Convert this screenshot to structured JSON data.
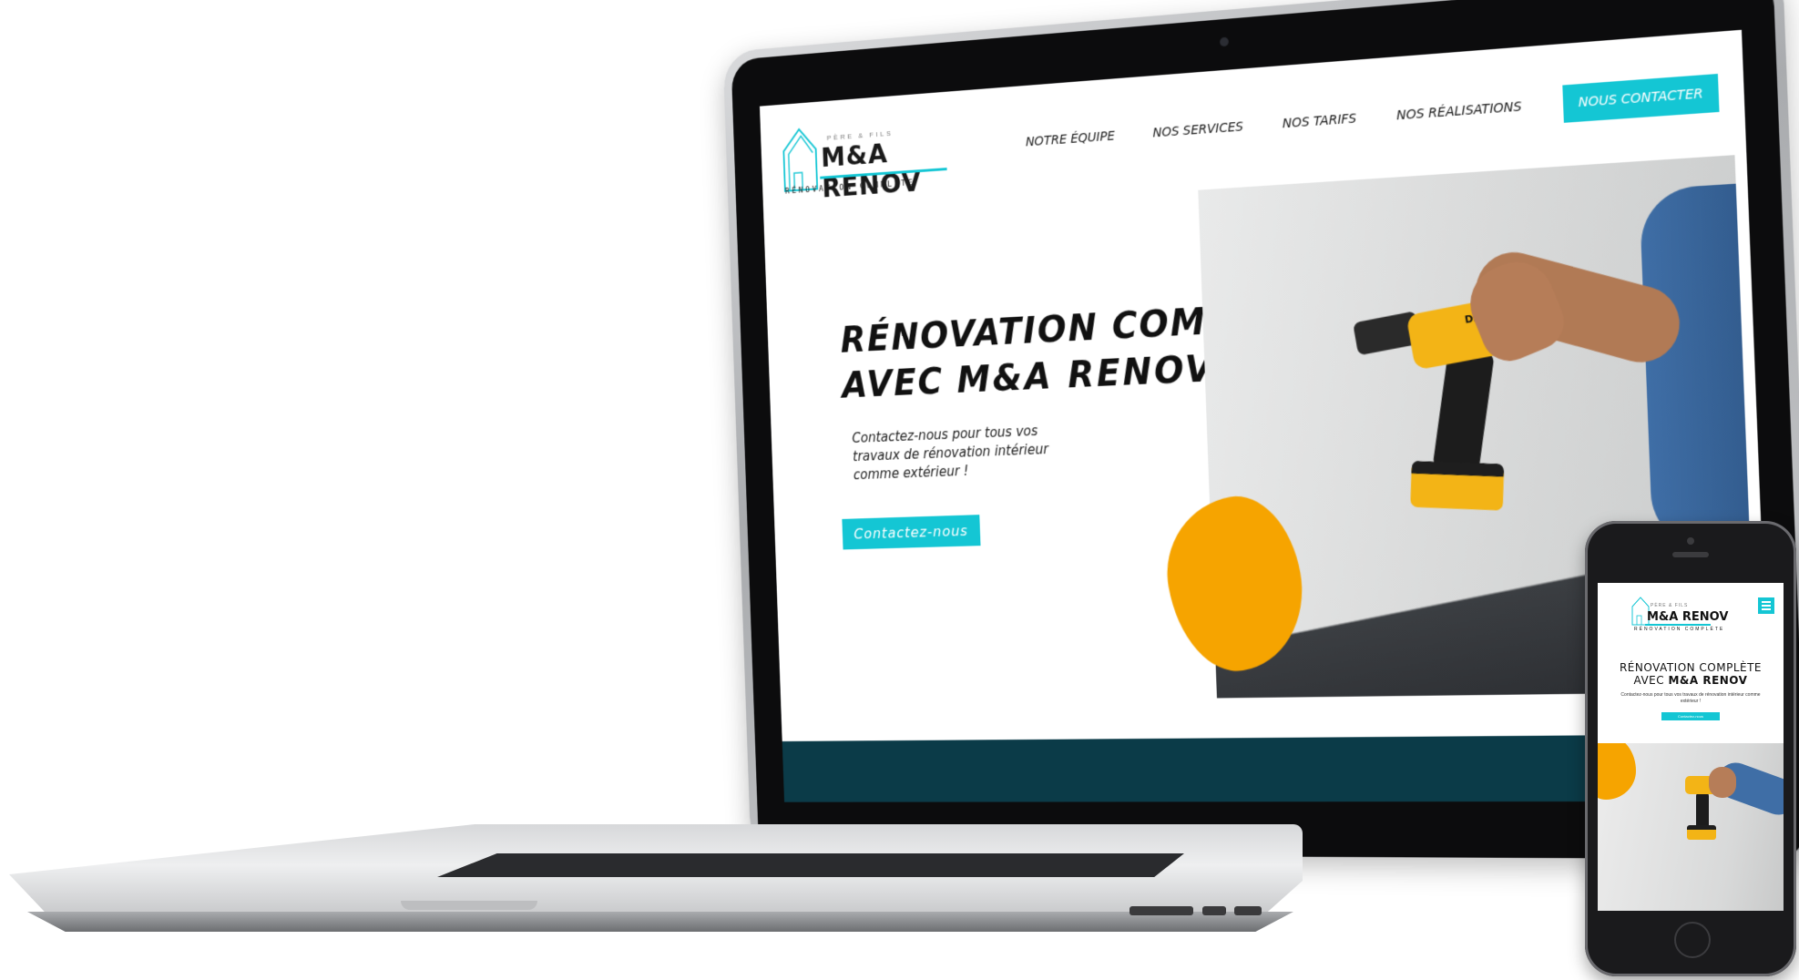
{
  "site": {
    "logo": {
      "tagline_small": "PÈRE & FILS",
      "name": "M&A RENOV",
      "subtitle": "RÉNOVATION COMPLÈTE"
    },
    "nav": {
      "items": [
        {
          "label": "NOTRE ÉQUIPE"
        },
        {
          "label": "NOS SERVICES"
        },
        {
          "label": "NOS TARIFS"
        },
        {
          "label": "NOS RÉALISATIONS"
        }
      ],
      "cta_label": "NOUS CONTACTER"
    },
    "hero": {
      "title_line1": "RÉNOVATION COMPLÈTE",
      "title_line2_prefix": "AVEC ",
      "title_line2_bold": "M&A RENOV",
      "description": "Contactez-nous pour tous vos travaux de rénovation intérieur comme extérieur !",
      "cta_label": "Contactez-nous"
    },
    "photo": {
      "drill_brand": "DEWALT"
    }
  },
  "mobile": {
    "logo_name": "M&A RENOV",
    "logo_small": "PÈRE & FILS",
    "logo_subtitle": "RÉNOVATION COMPLÈTE",
    "title_line1": "RÉNOVATION COMPLÈTE",
    "title_line2_prefix": "AVEC ",
    "title_line2_bold": "M&A RENOV",
    "description": "Contactez-nous pour tous vos travaux de rénovation intérieur comme extérieur !",
    "cta_label": "Contactez-nous",
    "menu_icon": "hamburger-icon"
  },
  "colors": {
    "accent": "#14c6d4",
    "orange": "#f6a400",
    "footer_band": "#0b3b48",
    "text": "#111111"
  }
}
